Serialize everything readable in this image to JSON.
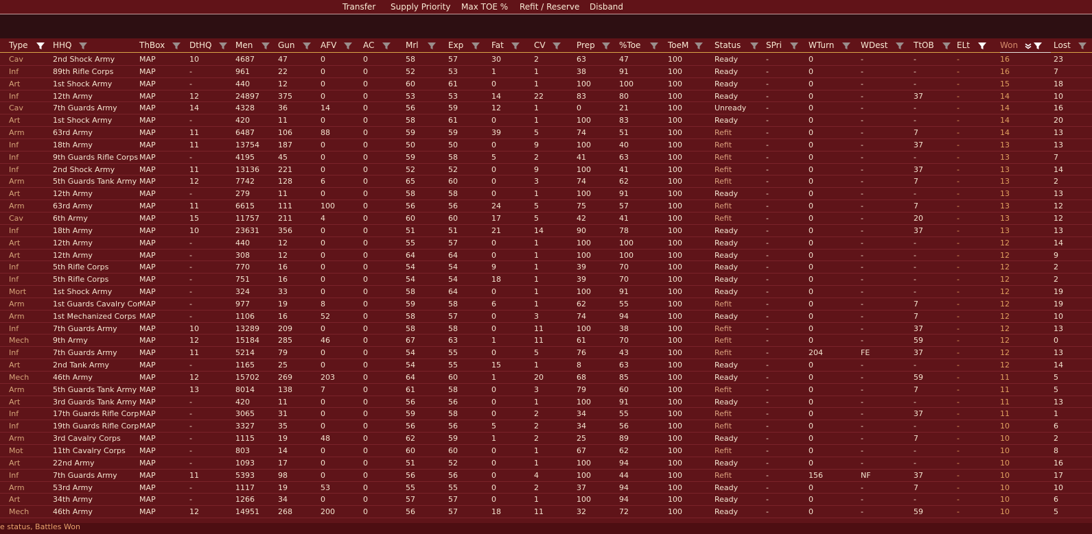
{
  "toolbar": {
    "transfer": "Transfer",
    "supply_priority": "Supply Priority",
    "max_toe": "Max TOE %",
    "refit_reserve": "Refit / Reserve",
    "disband": "Disband"
  },
  "columns": [
    {
      "key": "type",
      "label": "Type"
    },
    {
      "key": "hhq",
      "label": "HHQ"
    },
    {
      "key": "thbox",
      "label": "ThBox"
    },
    {
      "key": "dthq",
      "label": "DtHQ"
    },
    {
      "key": "men",
      "label": "Men"
    },
    {
      "key": "gun",
      "label": "Gun"
    },
    {
      "key": "afv",
      "label": "AFV"
    },
    {
      "key": "ac",
      "label": "AC"
    },
    {
      "key": "mrl",
      "label": "Mrl"
    },
    {
      "key": "exp",
      "label": "Exp"
    },
    {
      "key": "fat",
      "label": "Fat"
    },
    {
      "key": "cv",
      "label": "CV"
    },
    {
      "key": "prep",
      "label": "Prep"
    },
    {
      "key": "toe",
      "label": "%Toe"
    },
    {
      "key": "toem",
      "label": "ToeM"
    },
    {
      "key": "status",
      "label": "Status"
    },
    {
      "key": "spri",
      "label": "SPri"
    },
    {
      "key": "wturn",
      "label": "WTurn"
    },
    {
      "key": "wdest",
      "label": "WDest"
    },
    {
      "key": "ttob",
      "label": "TtOB"
    },
    {
      "key": "elt",
      "label": "ELt"
    },
    {
      "key": "won",
      "label": "Won"
    },
    {
      "key": "lost",
      "label": "Lost"
    }
  ],
  "rows": [
    [
      "Cav",
      "2nd Shock Army",
      "MAP",
      "10",
      "4687",
      "47",
      "0",
      "0",
      "58",
      "57",
      "30",
      "2",
      "63",
      "47",
      "100",
      "Ready",
      "-",
      "0",
      "-",
      "-",
      "-",
      "16",
      "23"
    ],
    [
      "Inf",
      "89th Rifle Corps",
      "MAP",
      "-",
      "961",
      "22",
      "0",
      "0",
      "52",
      "53",
      "1",
      "1",
      "38",
      "91",
      "100",
      "Ready",
      "-",
      "0",
      "-",
      "-",
      "-",
      "16",
      "7"
    ],
    [
      "Art",
      "1st Shock Army",
      "MAP",
      "-",
      "440",
      "12",
      "0",
      "0",
      "60",
      "61",
      "0",
      "1",
      "100",
      "100",
      "100",
      "Ready",
      "-",
      "0",
      "-",
      "-",
      "-",
      "15",
      "18"
    ],
    [
      "Inf",
      "12th Army",
      "MAP",
      "12",
      "24897",
      "375",
      "0",
      "0",
      "53",
      "53",
      "14",
      "22",
      "83",
      "80",
      "100",
      "Ready",
      "-",
      "0",
      "-",
      "37",
      "-",
      "14",
      "10"
    ],
    [
      "Cav",
      "7th Guards Army",
      "MAP",
      "14",
      "4328",
      "36",
      "14",
      "0",
      "56",
      "59",
      "12",
      "1",
      "0",
      "21",
      "100",
      "Unready",
      "-",
      "0",
      "-",
      "-",
      "-",
      "14",
      "16"
    ],
    [
      "Art",
      "1st Shock Army",
      "MAP",
      "-",
      "420",
      "11",
      "0",
      "0",
      "58",
      "61",
      "0",
      "1",
      "100",
      "83",
      "100",
      "Ready",
      "-",
      "0",
      "-",
      "-",
      "-",
      "14",
      "20"
    ],
    [
      "Arm",
      "63rd Army",
      "MAP",
      "11",
      "6487",
      "106",
      "88",
      "0",
      "59",
      "59",
      "39",
      "5",
      "74",
      "51",
      "100",
      "Refit",
      "-",
      "0",
      "-",
      "7",
      "-",
      "14",
      "13"
    ],
    [
      "Inf",
      "18th Army",
      "MAP",
      "11",
      "13754",
      "187",
      "0",
      "0",
      "50",
      "50",
      "0",
      "9",
      "100",
      "40",
      "100",
      "Refit",
      "-",
      "0",
      "-",
      "37",
      "-",
      "13",
      "13"
    ],
    [
      "Inf",
      "9th Guards Rifle Corps",
      "MAP",
      "-",
      "4195",
      "45",
      "0",
      "0",
      "59",
      "58",
      "5",
      "2",
      "41",
      "63",
      "100",
      "Refit",
      "-",
      "0",
      "-",
      "-",
      "-",
      "13",
      "7"
    ],
    [
      "Inf",
      "2nd Shock Army",
      "MAP",
      "11",
      "13136",
      "221",
      "0",
      "0",
      "52",
      "52",
      "0",
      "9",
      "100",
      "41",
      "100",
      "Refit",
      "-",
      "0",
      "-",
      "37",
      "-",
      "13",
      "14"
    ],
    [
      "Arm",
      "5th Guards Tank Army",
      "MAP",
      "12",
      "7742",
      "128",
      "6",
      "0",
      "65",
      "60",
      "0",
      "3",
      "74",
      "62",
      "100",
      "Refit",
      "-",
      "0",
      "-",
      "7",
      "-",
      "13",
      "2"
    ],
    [
      "Art",
      "12th Army",
      "MAP",
      "-",
      "279",
      "11",
      "0",
      "0",
      "58",
      "58",
      "0",
      "1",
      "100",
      "91",
      "100",
      "Ready",
      "-",
      "0",
      "-",
      "-",
      "-",
      "13",
      "13"
    ],
    [
      "Arm",
      "63rd Army",
      "MAP",
      "11",
      "6615",
      "111",
      "100",
      "0",
      "56",
      "56",
      "24",
      "5",
      "75",
      "57",
      "100",
      "Refit",
      "-",
      "0",
      "-",
      "7",
      "-",
      "13",
      "12"
    ],
    [
      "Cav",
      "6th Army",
      "MAP",
      "15",
      "11757",
      "211",
      "4",
      "0",
      "60",
      "60",
      "17",
      "5",
      "42",
      "41",
      "100",
      "Refit",
      "-",
      "0",
      "-",
      "20",
      "-",
      "13",
      "12"
    ],
    [
      "Inf",
      "18th Army",
      "MAP",
      "10",
      "23631",
      "356",
      "0",
      "0",
      "51",
      "51",
      "21",
      "14",
      "90",
      "78",
      "100",
      "Ready",
      "-",
      "0",
      "-",
      "37",
      "-",
      "13",
      "13"
    ],
    [
      "Art",
      "12th Army",
      "MAP",
      "-",
      "440",
      "12",
      "0",
      "0",
      "55",
      "57",
      "0",
      "1",
      "100",
      "100",
      "100",
      "Ready",
      "-",
      "0",
      "-",
      "-",
      "-",
      "12",
      "14"
    ],
    [
      "Art",
      "12th Army",
      "MAP",
      "-",
      "308",
      "12",
      "0",
      "0",
      "64",
      "64",
      "0",
      "1",
      "100",
      "100",
      "100",
      "Ready",
      "-",
      "0",
      "-",
      "-",
      "-",
      "12",
      "9"
    ],
    [
      "Inf",
      "5th Rifle Corps",
      "MAP",
      "-",
      "770",
      "16",
      "0",
      "0",
      "54",
      "54",
      "9",
      "1",
      "39",
      "70",
      "100",
      "Ready",
      "-",
      "0",
      "-",
      "-",
      "-",
      "12",
      "2"
    ],
    [
      "Inf",
      "5th Rifle Corps",
      "MAP",
      "-",
      "751",
      "16",
      "0",
      "0",
      "54",
      "54",
      "18",
      "1",
      "39",
      "70",
      "100",
      "Ready",
      "-",
      "0",
      "-",
      "-",
      "-",
      "12",
      "2"
    ],
    [
      "Mort",
      "1st Shock Army",
      "MAP",
      "-",
      "324",
      "33",
      "0",
      "0",
      "58",
      "64",
      "0",
      "1",
      "100",
      "91",
      "100",
      "Ready",
      "-",
      "0",
      "-",
      "-",
      "-",
      "12",
      "19"
    ],
    [
      "Arm",
      "1st Guards Cavalry Cor",
      "MAP",
      "-",
      "977",
      "19",
      "8",
      "0",
      "59",
      "58",
      "6",
      "1",
      "62",
      "55",
      "100",
      "Refit",
      "-",
      "0",
      "-",
      "7",
      "-",
      "12",
      "19"
    ],
    [
      "Arm",
      "1st Mechanized Corps",
      "MAP",
      "-",
      "1106",
      "16",
      "52",
      "0",
      "58",
      "57",
      "0",
      "3",
      "74",
      "94",
      "100",
      "Ready",
      "-",
      "0",
      "-",
      "7",
      "-",
      "12",
      "10"
    ],
    [
      "Inf",
      "7th Guards Army",
      "MAP",
      "10",
      "13289",
      "209",
      "0",
      "0",
      "58",
      "58",
      "0",
      "11",
      "100",
      "38",
      "100",
      "Refit",
      "-",
      "0",
      "-",
      "37",
      "-",
      "12",
      "13"
    ],
    [
      "Mech",
      "9th Army",
      "MAP",
      "12",
      "15184",
      "285",
      "46",
      "0",
      "67",
      "63",
      "1",
      "11",
      "61",
      "70",
      "100",
      "Refit",
      "-",
      "0",
      "-",
      "59",
      "-",
      "12",
      "0"
    ],
    [
      "Inf",
      "7th Guards Army",
      "MAP",
      "11",
      "5214",
      "79",
      "0",
      "0",
      "54",
      "55",
      "0",
      "5",
      "76",
      "43",
      "100",
      "Refit",
      "-",
      "204",
      "FE",
      "37",
      "-",
      "12",
      "13"
    ],
    [
      "Art",
      "2nd Tank Army",
      "MAP",
      "-",
      "1165",
      "25",
      "0",
      "0",
      "54",
      "55",
      "15",
      "1",
      "8",
      "63",
      "100",
      "Ready",
      "-",
      "0",
      "-",
      "-",
      "-",
      "12",
      "14"
    ],
    [
      "Mech",
      "46th Army",
      "MAP",
      "12",
      "15702",
      "269",
      "203",
      "0",
      "64",
      "60",
      "1",
      "20",
      "68",
      "85",
      "100",
      "Ready",
      "-",
      "0",
      "-",
      "59",
      "-",
      "11",
      "5"
    ],
    [
      "Arm",
      "5th Guards Tank Army",
      "MAP",
      "13",
      "8014",
      "138",
      "7",
      "0",
      "61",
      "58",
      "0",
      "3",
      "79",
      "60",
      "100",
      "Refit",
      "-",
      "0",
      "-",
      "7",
      "-",
      "11",
      "5"
    ],
    [
      "Art",
      "3rd Guards Tank Army",
      "MAP",
      "-",
      "420",
      "11",
      "0",
      "0",
      "56",
      "56",
      "0",
      "1",
      "100",
      "91",
      "100",
      "Ready",
      "-",
      "0",
      "-",
      "-",
      "-",
      "11",
      "13"
    ],
    [
      "Inf",
      "17th Guards Rifle Corp",
      "MAP",
      "-",
      "3065",
      "31",
      "0",
      "0",
      "59",
      "58",
      "0",
      "2",
      "34",
      "55",
      "100",
      "Refit",
      "-",
      "0",
      "-",
      "37",
      "-",
      "11",
      "1"
    ],
    [
      "Inf",
      "19th Guards Rifle Corp",
      "MAP",
      "-",
      "3327",
      "35",
      "0",
      "0",
      "56",
      "56",
      "5",
      "2",
      "34",
      "56",
      "100",
      "Refit",
      "-",
      "0",
      "-",
      "-",
      "-",
      "10",
      "6"
    ],
    [
      "Arm",
      "3rd Cavalry Corps",
      "MAP",
      "-",
      "1115",
      "19",
      "48",
      "0",
      "62",
      "59",
      "1",
      "2",
      "25",
      "89",
      "100",
      "Ready",
      "-",
      "0",
      "-",
      "7",
      "-",
      "10",
      "2"
    ],
    [
      "Mot",
      "11th Cavalry Corps",
      "MAP",
      "-",
      "803",
      "14",
      "0",
      "0",
      "60",
      "60",
      "0",
      "1",
      "67",
      "62",
      "100",
      "Refit",
      "-",
      "0",
      "-",
      "-",
      "-",
      "10",
      "8"
    ],
    [
      "Art",
      "22nd Army",
      "MAP",
      "-",
      "1093",
      "17",
      "0",
      "0",
      "51",
      "52",
      "0",
      "1",
      "100",
      "94",
      "100",
      "Ready",
      "-",
      "0",
      "-",
      "-",
      "-",
      "10",
      "16"
    ],
    [
      "Inf",
      "7th Guards Army",
      "MAP",
      "11",
      "5393",
      "98",
      "0",
      "0",
      "56",
      "56",
      "0",
      "4",
      "100",
      "44",
      "100",
      "Refit",
      "-",
      "156",
      "NF",
      "37",
      "-",
      "10",
      "17"
    ],
    [
      "Arm",
      "53rd Army",
      "MAP",
      "-",
      "1117",
      "19",
      "53",
      "0",
      "55",
      "55",
      "0",
      "2",
      "37",
      "94",
      "100",
      "Ready",
      "-",
      "0",
      "-",
      "7",
      "-",
      "10",
      "10"
    ],
    [
      "Art",
      "34th Army",
      "MAP",
      "-",
      "1266",
      "34",
      "0",
      "0",
      "57",
      "57",
      "0",
      "1",
      "100",
      "94",
      "100",
      "Ready",
      "-",
      "0",
      "-",
      "-",
      "-",
      "10",
      "6"
    ],
    [
      "Mech",
      "46th Army",
      "MAP",
      "12",
      "14951",
      "268",
      "200",
      "0",
      "56",
      "57",
      "18",
      "11",
      "32",
      "72",
      "100",
      "Ready",
      "-",
      "0",
      "-",
      "59",
      "-",
      "10",
      "5"
    ]
  ],
  "footer": {
    "text": "e status, Battles Won"
  },
  "colors": {
    "background": "#5f1419",
    "header": "#611318",
    "band": "#2d0f12",
    "row_divider": "#7b232a",
    "accent_text": "#e0a060",
    "refit_text": "#dba07c"
  }
}
